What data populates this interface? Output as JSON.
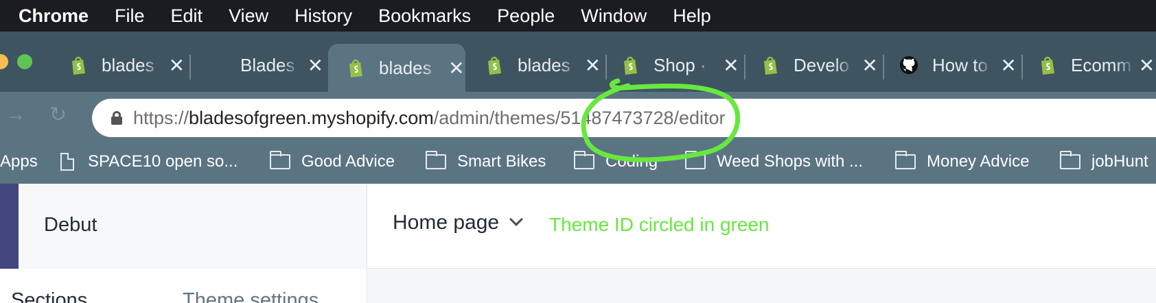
{
  "menubar": {
    "app": "Chrome",
    "items": [
      "File",
      "Edit",
      "View",
      "History",
      "Bookmarks",
      "People",
      "Window",
      "Help"
    ]
  },
  "tabs": [
    {
      "title": "blades",
      "icon": "shopify-icon",
      "active": false
    },
    {
      "title": "Blades",
      "icon": "none",
      "active": false
    },
    {
      "title": "blades",
      "icon": "shopify-icon",
      "active": true
    },
    {
      "title": "blades",
      "icon": "shopify-icon",
      "active": false
    },
    {
      "title": "Shop ·",
      "icon": "shopify-icon",
      "active": false
    },
    {
      "title": "Develo",
      "icon": "shopify-icon",
      "active": false
    },
    {
      "title": "How to",
      "icon": "github-icon",
      "active": false
    },
    {
      "title": "Ecomm",
      "icon": "shopify-icon",
      "active": false
    }
  ],
  "tab_close_glyph": "✕",
  "address_bar": {
    "prefix": "https://",
    "host": "bladesofgreen.myshopify.com",
    "path": "/admin/themes/51487473728/editor"
  },
  "bookmarks": [
    {
      "label": "Apps",
      "icon": "apps-icon"
    },
    {
      "label": "SPACE10 open so...",
      "icon": "page-icon"
    },
    {
      "label": "Good Advice",
      "icon": "folder-icon"
    },
    {
      "label": "Smart Bikes",
      "icon": "folder-icon"
    },
    {
      "label": "Coding",
      "icon": "folder-icon"
    },
    {
      "label": "Weed Shops with ...",
      "icon": "folder-icon"
    },
    {
      "label": "Money Advice",
      "icon": "folder-icon"
    },
    {
      "label": "jobHunt",
      "icon": "folder-icon"
    }
  ],
  "editor": {
    "theme_name": "Debut",
    "page_selector": "Home page",
    "annotation": "Theme ID circled in green",
    "sidebar_tabs": [
      "Sections",
      "Theme settings"
    ]
  },
  "colors": {
    "annotation_green": "#67e83f",
    "shopify_green": "#95bf47",
    "chrome_frame": "#3f5461",
    "toolbar": "#5b7482"
  }
}
